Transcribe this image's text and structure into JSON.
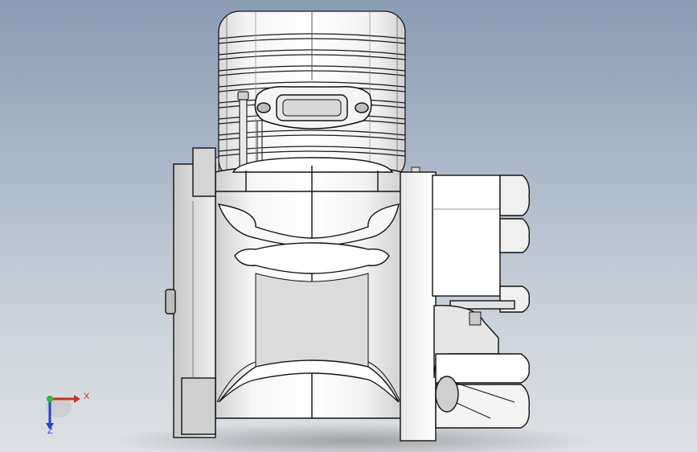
{
  "viewport": {
    "model": "engine-assembly",
    "background_top": "#8a9bb4",
    "background_bottom": "#dde1e5"
  },
  "triad": {
    "x_label": "X",
    "z_label": "Z",
    "x_color": "#d52a20",
    "y_color": "#2fb93a",
    "z_color": "#2840c8"
  }
}
